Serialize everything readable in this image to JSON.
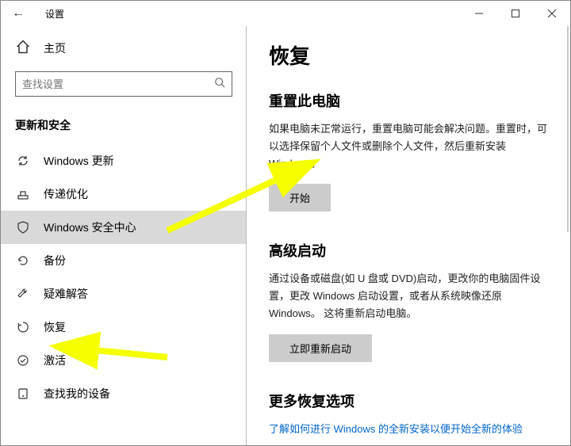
{
  "titlebar": {
    "title": "设置"
  },
  "home_label": "主页",
  "search": {
    "placeholder": "查找设置"
  },
  "section_title": "更新和安全",
  "nav": [
    {
      "label": "Windows 更新"
    },
    {
      "label": "传递优化"
    },
    {
      "label": "Windows 安全中心"
    },
    {
      "label": "备份"
    },
    {
      "label": "疑难解答"
    },
    {
      "label": "恢复"
    },
    {
      "label": "激活"
    },
    {
      "label": "查找我的设备"
    }
  ],
  "main": {
    "heading": "恢复",
    "reset": {
      "title": "重置此电脑",
      "desc": "如果电脑未正常运行，重置电脑可能会解决问题。重置时，可以选择保留个人文件或删除个人文件，然后重新安装Windows。",
      "button": "开始"
    },
    "advanced": {
      "title": "高级启动",
      "desc": "通过设备或磁盘(如 U 盘或 DVD)启动，更改你的电脑固件设置，更改 Windows 启动设置，或者从系统映像还原 Windows。 这将重新启动电脑。",
      "button": "立即重新启动"
    },
    "more": {
      "title": "更多恢复选项",
      "link": "了解如何进行 Windows 的全新安装以便开始全新的体验"
    }
  }
}
